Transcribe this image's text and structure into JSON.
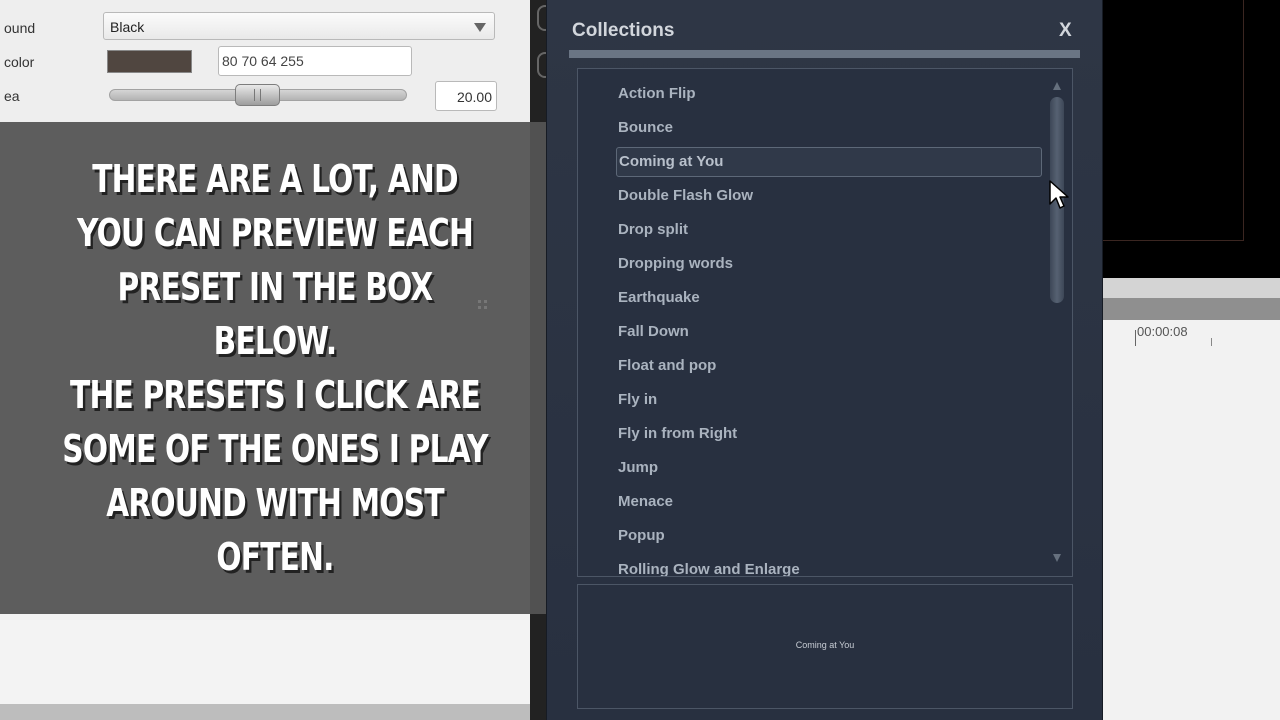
{
  "properties": {
    "background_label": "ound",
    "background_value": "Black",
    "color_label": "color",
    "color_value": "80 70 64 255",
    "swatch_color": "#504640",
    "area_label": "ea",
    "area_value": "20.00",
    "area_slider_fraction": 0.43
  },
  "caption": {
    "line1": "There are a lot, and you can preview each preset in the box below.",
    "line2": "The presets I click are some of the ones I play around with most often."
  },
  "dialog": {
    "title": "Collections",
    "close_label": "X",
    "items": [
      "Action Flip",
      "Bounce",
      "Coming at You",
      "Double Flash Glow",
      "Drop split",
      "Dropping words",
      "Earthquake",
      "Fall Down",
      "Float and pop",
      "Fly in",
      "Fly in from Right",
      "Jump",
      "Menace",
      "Popup",
      "Rolling Glow and Enlarge"
    ],
    "selected_item": "Coming at You",
    "preview_text": "Coming at You"
  },
  "timeline": {
    "timecode": "00:00:08"
  },
  "colors": {
    "dialog_bg": "#2e3645",
    "caption_bg": "#555555",
    "item_text": "#aab3bf"
  }
}
